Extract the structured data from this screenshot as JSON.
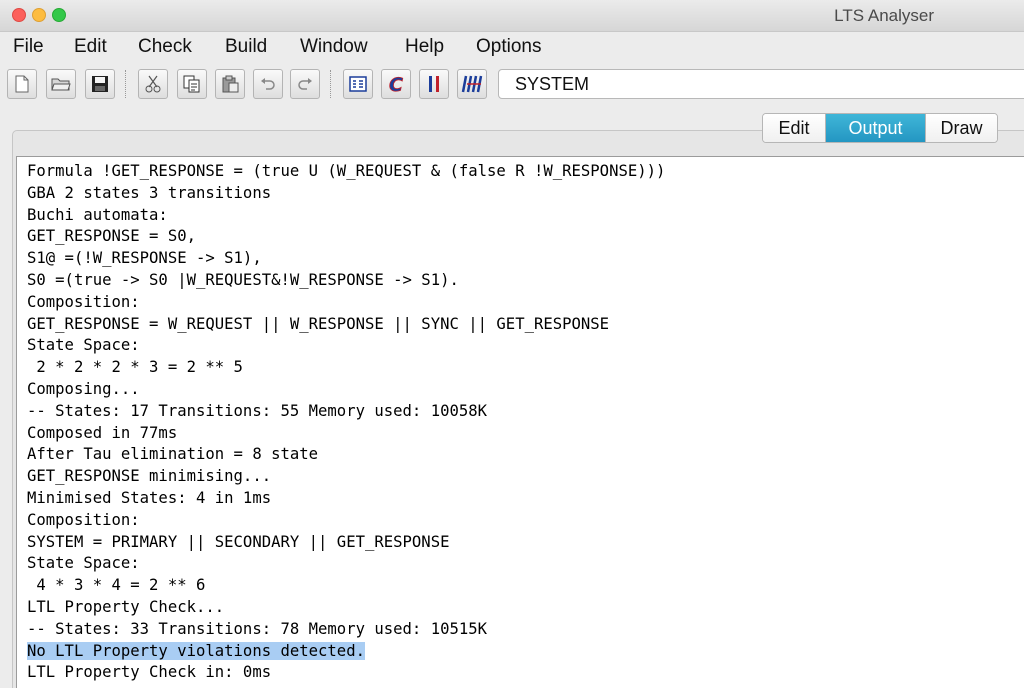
{
  "window": {
    "title": "LTS Analyser"
  },
  "menu": [
    "File",
    "Edit",
    "Check",
    "Build",
    "Window",
    "Help",
    "Options"
  ],
  "toolbar": {
    "buttons": [
      "new-file-icon",
      "open-folder-icon",
      "save-icon",
      "cut-icon",
      "copy-icon",
      "paste-icon",
      "undo-icon",
      "redo-icon",
      "compile-icon",
      "check-safety-icon",
      "parallel-icon",
      "minimise-icon"
    ],
    "target": "SYSTEM"
  },
  "tabs": {
    "labels": [
      "Edit",
      "Output",
      "Draw"
    ],
    "active": "Output",
    "accent": "#2aa3cb"
  },
  "output": {
    "lines": [
      "Formula !GET_RESPONSE = (true U (W_REQUEST & (false R !W_RESPONSE)))",
      "GBA 2 states 3 transitions",
      "Buchi automata:",
      "GET_RESPONSE = S0,",
      "S1@ =(!W_RESPONSE -> S1),",
      "S0 =(true -> S0 |W_REQUEST&!W_RESPONSE -> S1).",
      "Composition:",
      "GET_RESPONSE = W_REQUEST || W_RESPONSE || SYNC || GET_RESPONSE",
      "State Space:",
      " 2 * 2 * 2 * 3 = 2 ** 5",
      "Composing...",
      "-- States: 17 Transitions: 55 Memory used: 10058K",
      "Composed in 77ms",
      "After Tau elimination = 8 state",
      "GET_RESPONSE minimising...",
      "Minimised States: 4 in 1ms",
      "Composition:",
      "SYSTEM = PRIMARY || SECONDARY || GET_RESPONSE",
      "State Space:",
      " 4 * 3 * 4 = 2 ** 6",
      "LTL Property Check...",
      "-- States: 33 Transitions: 78 Memory used: 10515K",
      "No LTL Property violations detected.",
      "LTL Property Check in: 0ms"
    ],
    "highlighted_line": 22,
    "highlight_color": "#a9cdf3"
  }
}
